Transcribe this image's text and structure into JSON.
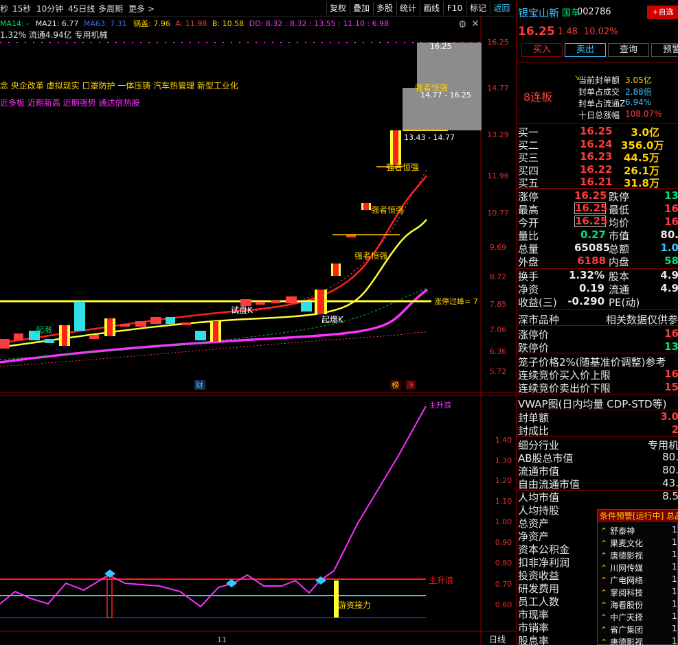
{
  "toolbar": {
    "periods": [
      "秒",
      "15秒",
      "10分钟",
      "45日线",
      "多周期",
      "更多 >"
    ],
    "buttons": [
      "复权",
      "叠加",
      "多股",
      "统计",
      "画线",
      "F10",
      "标记",
      "返回"
    ]
  },
  "indicator_line": {
    "ma14": "MA14: -",
    "ma21": "MA21: 6.77",
    "ma63": "MA63: 7.31",
    "guogai": "锅盖: 7.96",
    "a": "A: 11.98",
    "b": "B: 10.58",
    "dd": "DD: 8.32 : 8.32 : 13.55 : 11.10 : 6.98"
  },
  "chart_info": {
    "float_line": "1.32% 流通4.94亿 专用机械",
    "concepts": "念 央企改革 虚拟现实 口罩防护 一体压铸 汽车热管理 新型工业化",
    "tags": "近多板 近期新高 近期强势 通达信热股"
  },
  "price_axis": [
    "16.25",
    "14.77",
    "13.29",
    "11.96",
    "10.77",
    "9.69",
    "8.72",
    "7.85",
    "7.06",
    "6.36",
    "5.72"
  ],
  "osc_axis": [
    "1.40",
    "1.30",
    "1.20",
    "1.10",
    "1.00",
    "0.90",
    "0.80",
    "0.70",
    "0.60"
  ],
  "annotations": {
    "qiqiang": "强者恒强",
    "qiqiang2": "强者恒强",
    "qiqiang3": "强者恒强",
    "qiqiang4": "强者恒强",
    "box1": "14.77 - 16.25",
    "box1_top": "16.25",
    "box2": "13.43 - 14.77",
    "zhangting": "涨停过峰= 7",
    "shipan": "试盘K",
    "qibao": "起爆K",
    "qizhang": "起涨",
    "cai": "财",
    "bang": "榜",
    "zhang": "涨",
    "zhushengbo": "主升浪",
    "youzi": "游资接力",
    "top_label": "主升浪",
    "bottom_date": "11",
    "bottom_period": "日线"
  },
  "stock": {
    "name": "银宝山新",
    "tag": "国车",
    "code": "002786",
    "add_btn": "+自选",
    "price": "16.25",
    "change": "1.48",
    "pct": "10.02%",
    "buttons": [
      "买入",
      "卖出",
      "查询",
      "预警"
    ],
    "board": "8连板",
    "seal_rows": [
      {
        "label": "当前封单额",
        "value": "3.05亿",
        "color": "#ffd200"
      },
      {
        "label": "封单占成交",
        "value": "2.88倍",
        "color": "#39c6ff"
      },
      {
        "label": "封单占流通Z",
        "value": "6.94%",
        "color": "#39c6ff"
      },
      {
        "label": "十日总涨幅",
        "value": "108.07%",
        "color": "#ff4040"
      }
    ],
    "buy_levels": [
      {
        "label": "买一",
        "price": "16.25",
        "vol": "3.0亿"
      },
      {
        "label": "买二",
        "price": "16.24",
        "vol": "356.0万"
      },
      {
        "label": "买三",
        "price": "16.23",
        "vol": "44.5万"
      },
      {
        "label": "买四",
        "price": "16.22",
        "vol": "26.1万"
      },
      {
        "label": "买五",
        "price": "16.21",
        "vol": "31.8万"
      }
    ],
    "quote_rows": [
      {
        "l1": "涨停",
        "v1": "16.25",
        "c1": "red",
        "l2": "跌停",
        "v2": "13",
        "c2": "green"
      },
      {
        "l1": "最高",
        "v1": "16.25",
        "c1": "red",
        "l2": "最低",
        "v2": "16",
        "c2": "red"
      },
      {
        "l1": "今开",
        "v1": "16.25",
        "c1": "red",
        "l2": "均价",
        "v2": "16",
        "c2": "red"
      },
      {
        "l1": "量比",
        "v1": "0.27",
        "c1": "green",
        "l2": "市值",
        "v2": "80.",
        "c2": "white"
      },
      {
        "l1": "总量",
        "v1": "65085",
        "c1": "white",
        "l2": "总额",
        "v2": "1.0",
        "c2": "cyan"
      },
      {
        "l1": "外盘",
        "v1": "6188",
        "c1": "red",
        "l2": "内盘",
        "v2": "58",
        "c2": "green"
      }
    ],
    "fin_rows": [
      {
        "l1": "换手",
        "v1": "1.32%",
        "l2": "股本",
        "v2": "4.9"
      },
      {
        "l1": "净资",
        "v1": "0.19",
        "l2": "流通",
        "v2": "4.9"
      },
      {
        "l1": "收益(三)",
        "v1": "-0.290",
        "l2": "PE(动)",
        "v2": ""
      }
    ],
    "market": "深市品种",
    "market_note": "相关数据仅供参",
    "limit_rows": [
      {
        "label": "涨停价",
        "value": "16"
      },
      {
        "label": "跌停价",
        "value": "13"
      }
    ],
    "cage_title": "笼子价格2%(随基准价调整)参考",
    "auction_rows": [
      {
        "label": "连续竞价买入价上限",
        "value": "16"
      },
      {
        "label": "连续竞价卖出价下限",
        "value": "15"
      }
    ],
    "vwap": "VWAP图(日内均量 CDP-STD等)",
    "seal_amt": [
      {
        "label": "封单额",
        "value": "3.0"
      },
      {
        "label": "封成比",
        "value": "2"
      }
    ],
    "profile_rows": [
      {
        "label": "细分行业",
        "value": "专用机"
      },
      {
        "label": "AB股总市值",
        "value": "80."
      },
      {
        "label": "流通市值",
        "value": "80."
      },
      {
        "label": "自由流通市值",
        "value": "43."
      },
      {
        "label": "人均市值",
        "value": "8.5"
      },
      {
        "label": "人均持股",
        "value": ""
      },
      {
        "label": "总资产",
        "value": ""
      },
      {
        "label": "净资产",
        "value": ""
      },
      {
        "label": "资本公积金",
        "value": ""
      },
      {
        "label": "扣非净利润",
        "value": ""
      },
      {
        "label": "投资收益",
        "value": ""
      },
      {
        "label": "研发费用",
        "value": ""
      },
      {
        "label": "员工人数",
        "value": ""
      },
      {
        "label": "市现率",
        "value": ""
      },
      {
        "label": "市销率",
        "value": ""
      },
      {
        "label": "股息率",
        "value": ""
      }
    ]
  },
  "alert": {
    "title": "条件预警[运行中] 总品",
    "items": [
      {
        "name": "舒泰神",
        "n": "1"
      },
      {
        "name": "果麦文化",
        "n": "1"
      },
      {
        "name": "唐德影视",
        "n": "1"
      },
      {
        "name": "川网传媒",
        "n": "1"
      },
      {
        "name": "广电网络",
        "n": "1"
      },
      {
        "name": "掌阅科技",
        "n": "1"
      },
      {
        "name": "海看股份",
        "n": "1"
      },
      {
        "name": "中广天择",
        "n": "1"
      },
      {
        "name": "省广集团",
        "n": "1"
      },
      {
        "name": "唐德影视",
        "n": "1"
      }
    ]
  },
  "colors": {
    "up": "#ff3b3b",
    "down": "#00e070",
    "accent": "#ffd200",
    "ma_magenta": "#ff30ff"
  }
}
